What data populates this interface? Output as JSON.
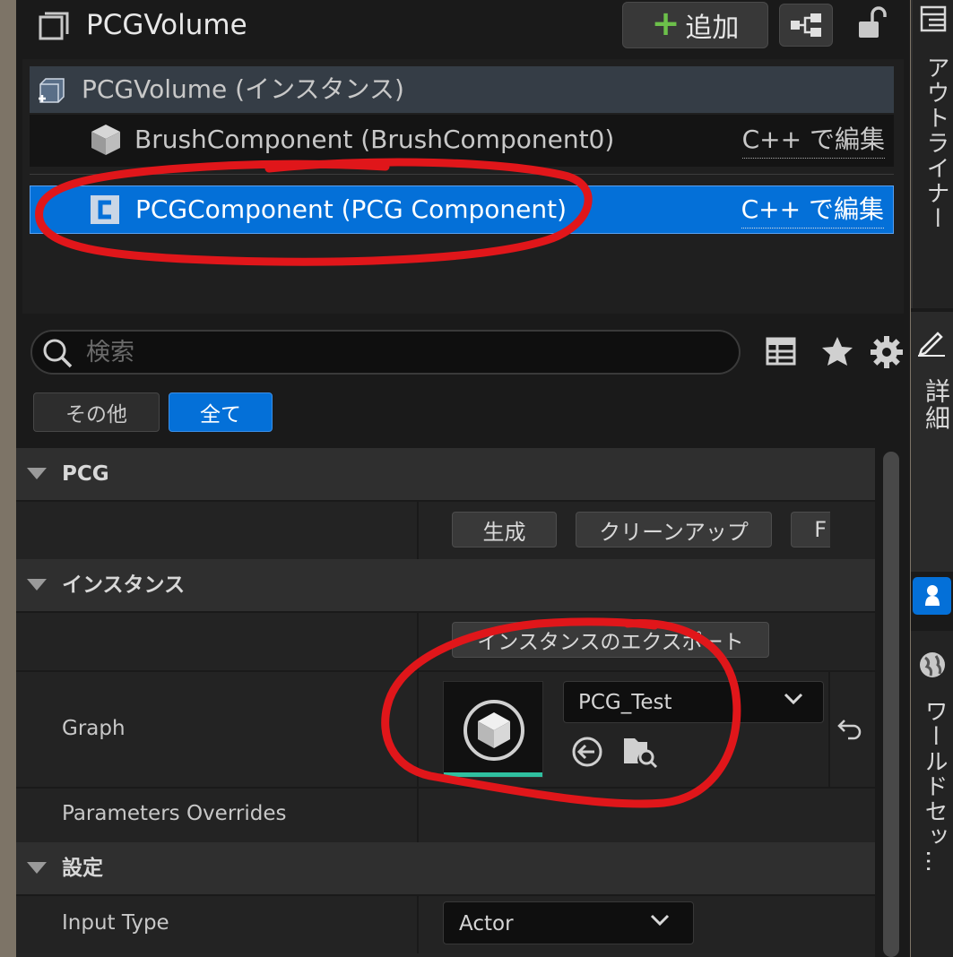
{
  "header": {
    "title": "PCGVolume",
    "add_label": "追加"
  },
  "tree": {
    "root_label": "PCGVolume (インスタンス)",
    "brush_label": "BrushComponent (BrushComponent0)",
    "brush_edit": "C++ で編集",
    "pcg_label": "PCGComponent (PCG Component)",
    "pcg_edit": "C++ で編集"
  },
  "search": {
    "placeholder": "検索"
  },
  "filters": {
    "other": "その他",
    "all": "全て"
  },
  "details": {
    "cat_pcg": "PCG",
    "btn_generate": "生成",
    "btn_cleanup": "クリーンアップ",
    "btn_partial": "F",
    "cat_instance": "インスタンス",
    "btn_export": "インスタンスのエクスポート",
    "graph_label": "Graph",
    "graph_asset": "PCG_Test",
    "params_label": "Parameters Overrides",
    "cat_settings": "設定",
    "input_type_label": "Input Type",
    "input_type_value": "Actor"
  },
  "side_tabs": {
    "outliner": "アウトライナー",
    "details": "詳細",
    "world": "ワールドセッ…"
  },
  "colors": {
    "selection": "#0470d8",
    "accent_green": "#6cc04a",
    "annotation_red": "#e0161a",
    "asset_bar": "#2fc0a0"
  }
}
